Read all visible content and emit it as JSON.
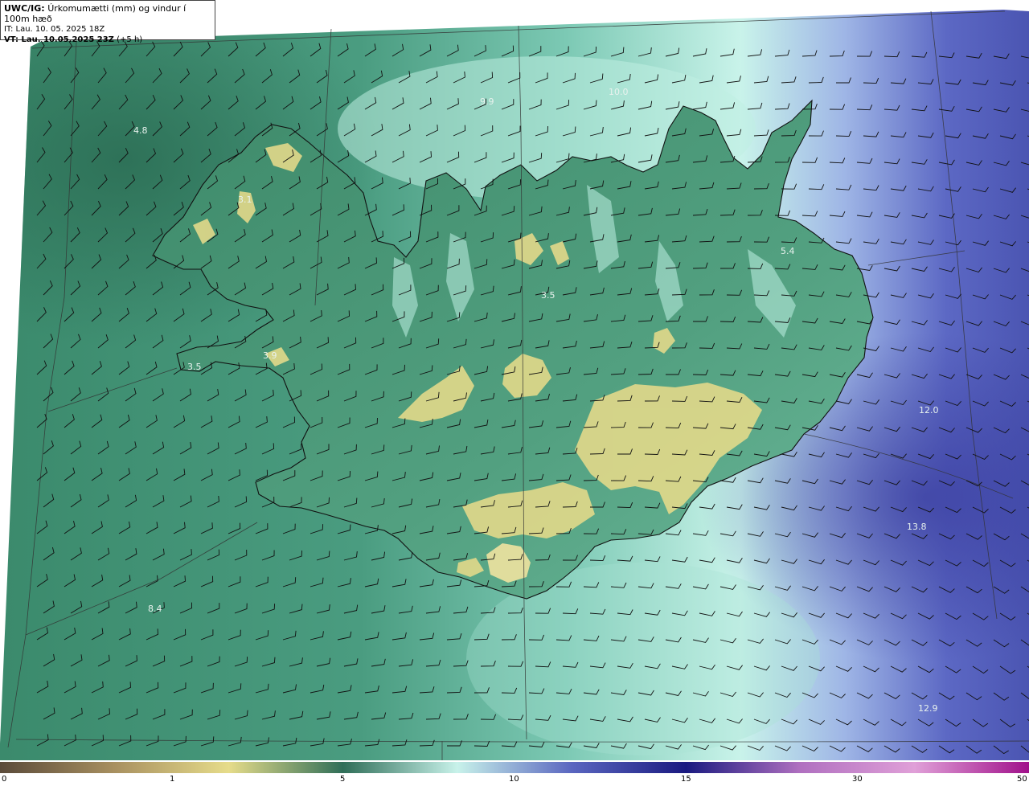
{
  "header": {
    "product": "UWC/IG:",
    "title": "Úrkomumætti (mm) og vindur í 100m hæð",
    "it_line": "IT: Lau. 10. 05. 2025 18Z",
    "vt_label": "VT: Lau. 10.05.2025 23Z",
    "vt_offset": "(+5 h)"
  },
  "colorbar": {
    "ticks": [
      "0",
      "1",
      "5",
      "10",
      "15",
      "30",
      "50"
    ],
    "stops": [
      "#5a4a3a",
      "#a89060",
      "#e6dc8a",
      "#2f6e58",
      "#c8f2ea",
      "#5a66c0",
      "#1a1a80",
      "#b070c0",
      "#e0a0d8",
      "#a0108a"
    ]
  },
  "map_labels": [
    {
      "text": "4.8"
    },
    {
      "text": "3.1"
    },
    {
      "text": "3.5"
    },
    {
      "text": "3.9"
    },
    {
      "text": "9.9"
    },
    {
      "text": "10.0"
    },
    {
      "text": "5.4"
    },
    {
      "text": "3.5"
    },
    {
      "text": "12.0"
    },
    {
      "text": "13.8"
    },
    {
      "text": "12.9"
    },
    {
      "text": "8.4"
    }
  ],
  "colors": {
    "ocean_west": "#3f8f72",
    "ocean_east": "#4a5ab8",
    "land_high": "#e4d98a",
    "coast": "#111111"
  }
}
